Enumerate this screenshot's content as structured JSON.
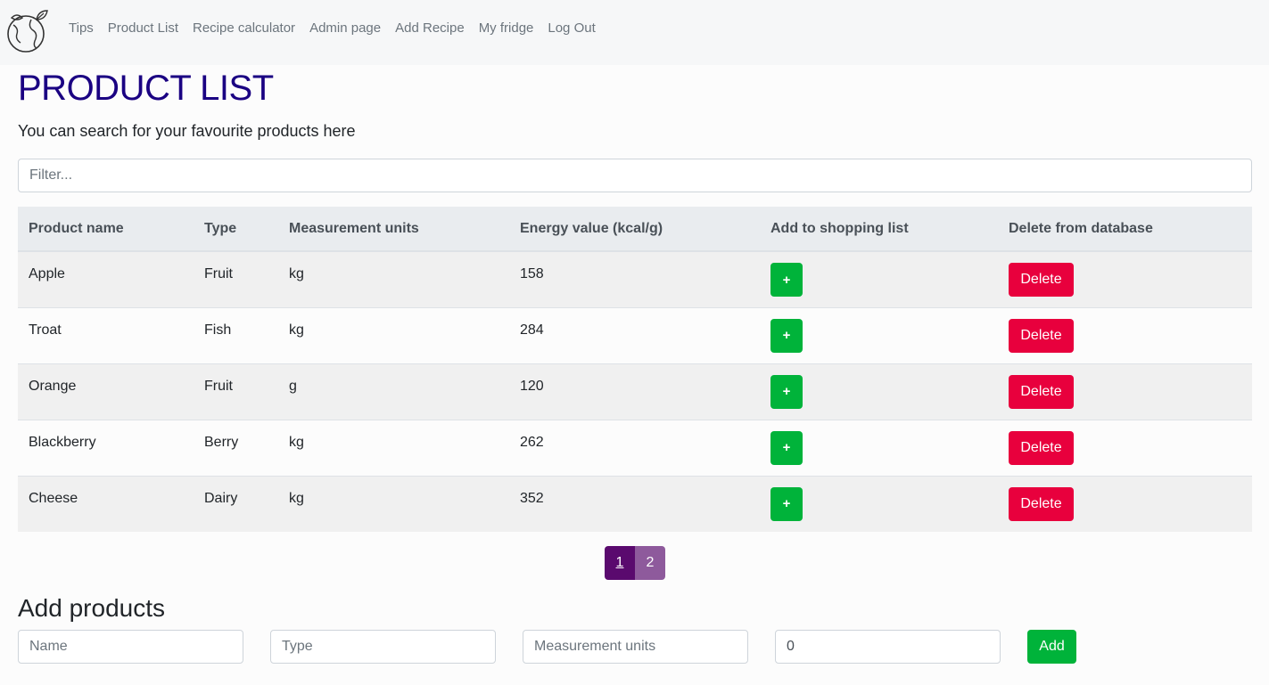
{
  "nav": {
    "logo_icon": "globe-leaf-icon",
    "links": [
      "Tips",
      "Product List",
      "Recipe calculator",
      "Admin page",
      "Add Recipe",
      "My fridge",
      "Log Out"
    ]
  },
  "page": {
    "title": "PRODUCT LIST",
    "subtitle": "You can search for your favourite products here",
    "filter_placeholder": "Filter..."
  },
  "table": {
    "headers": [
      "Product name",
      "Type",
      "Measurement units",
      "Energy value (kcal/g)",
      "Add to shopping list",
      "Delete from database"
    ],
    "rows": [
      {
        "name": "Apple",
        "type": "Fruit",
        "units": "kg",
        "energy": "158"
      },
      {
        "name": "Troat",
        "type": "Fish",
        "units": "kg",
        "energy": "284"
      },
      {
        "name": "Orange",
        "type": "Fruit",
        "units": "g",
        "energy": "120"
      },
      {
        "name": "Blackberry",
        "type": "Berry",
        "units": "kg",
        "energy": "262"
      },
      {
        "name": "Cheese",
        "type": "Dairy",
        "units": "kg",
        "energy": "352"
      }
    ],
    "add_label": "+",
    "delete_label": "Delete"
  },
  "pagination": {
    "pages": [
      "1",
      "2"
    ],
    "current": "1"
  },
  "add_products": {
    "title": "Add products",
    "name_placeholder": "Name",
    "type_placeholder": "Type",
    "units_placeholder": "Measurement units",
    "energy_value": "0",
    "add_label": "Add"
  },
  "colors": {
    "title": "#1a0082",
    "green": "#00b33a",
    "red": "#e8003d",
    "page_active": "#5a0a6e",
    "page_inactive": "#8e5a9c"
  }
}
